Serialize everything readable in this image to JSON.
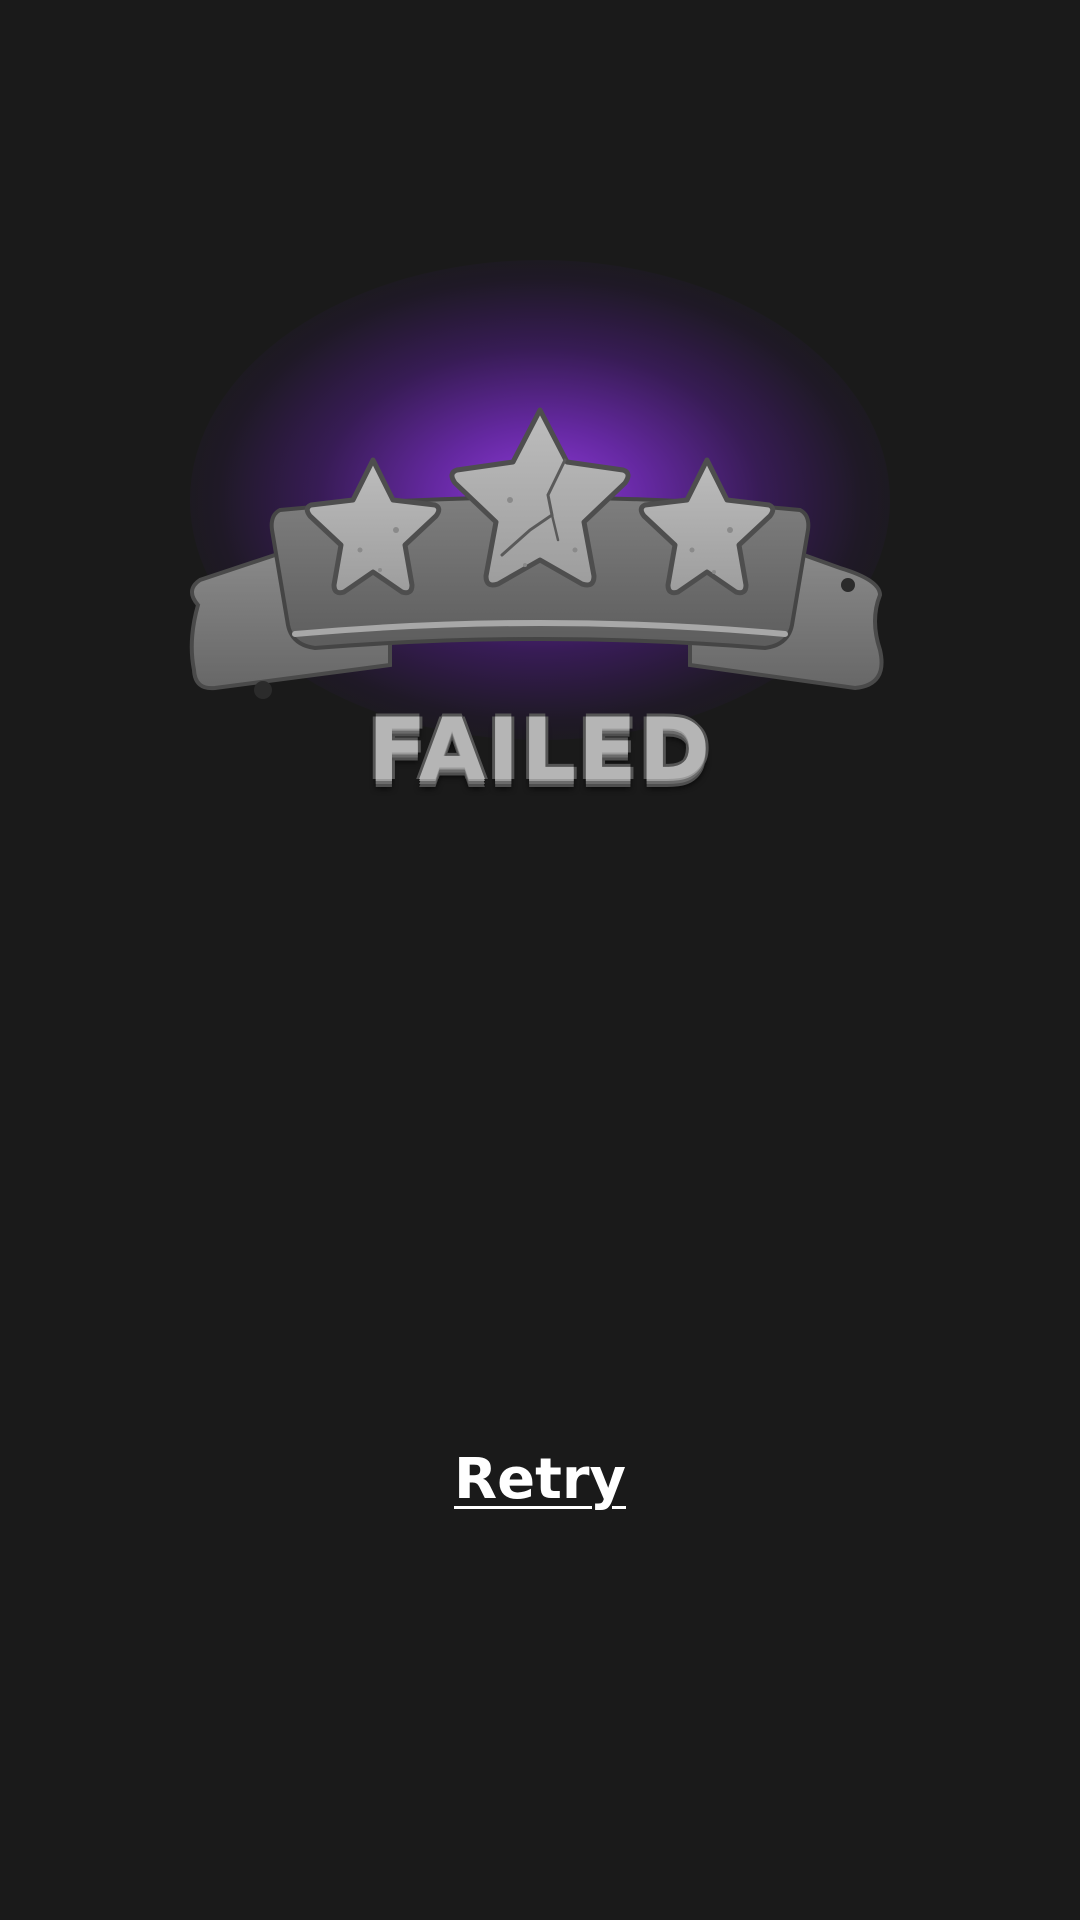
{
  "result": {
    "title": "FAILED",
    "stars_earned": 0,
    "stars_total": 3
  },
  "actions": {
    "retry_label": "Retry"
  },
  "colors": {
    "background": "#1a1a1a",
    "glow": "#8a3fd1",
    "stone": "#8c8c8c",
    "text": "#ffffff"
  },
  "icons": [
    "star-icon",
    "cracked-star-icon",
    "star-icon"
  ]
}
